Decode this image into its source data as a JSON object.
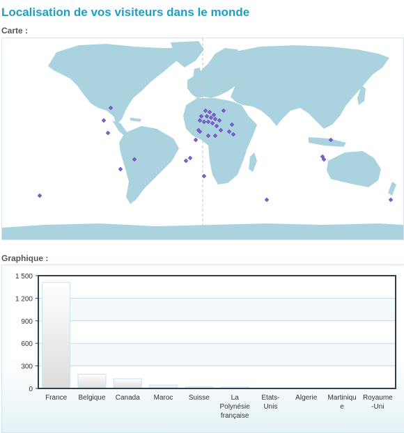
{
  "page": {
    "title": "Localisation de vos visiteurs dans le monde",
    "map_label": "Carte :",
    "chart_label": "Graphique :"
  },
  "colors": {
    "title": "#1d9fc2",
    "land": "#aad3df",
    "marker": "#7b5fd1",
    "bar_top": "#ffffff",
    "bar_bottom": "#dcdcdc",
    "plot_border": "#2b4150"
  },
  "map": {
    "marker_icon": "purple-diamond-icon",
    "markers_count_note": ""
  },
  "chart_data": {
    "type": "bar",
    "categories": [
      "France",
      "Belgique",
      "Canada",
      "Maroc",
      "Suisse",
      "La Polynésie française",
      "Etats-Unis",
      "Algerie",
      "Martinique",
      "Royaume-Uni"
    ],
    "category_lines": [
      [
        "France"
      ],
      [
        "Belgique"
      ],
      [
        "Canada"
      ],
      [
        "Maroc"
      ],
      [
        "Suisse"
      ],
      [
        "La",
        "Polynésie",
        "française"
      ],
      [
        "Etats-",
        "Unis"
      ],
      [
        "Algerie"
      ],
      [
        "Martiniqu",
        "e"
      ],
      [
        "Royaume",
        "-Uni"
      ]
    ],
    "values": [
      1410,
      190,
      130,
      45,
      22,
      20,
      5,
      3,
      2,
      2
    ],
    "ylim": [
      0,
      1500
    ],
    "yticks": [
      0,
      300,
      600,
      900,
      1200,
      1500
    ],
    "ytick_labels": [
      "0",
      "300",
      "600",
      "900",
      "1 200",
      "1 500"
    ],
    "grid": true,
    "title": "",
    "xlabel": "",
    "ylabel": ""
  }
}
